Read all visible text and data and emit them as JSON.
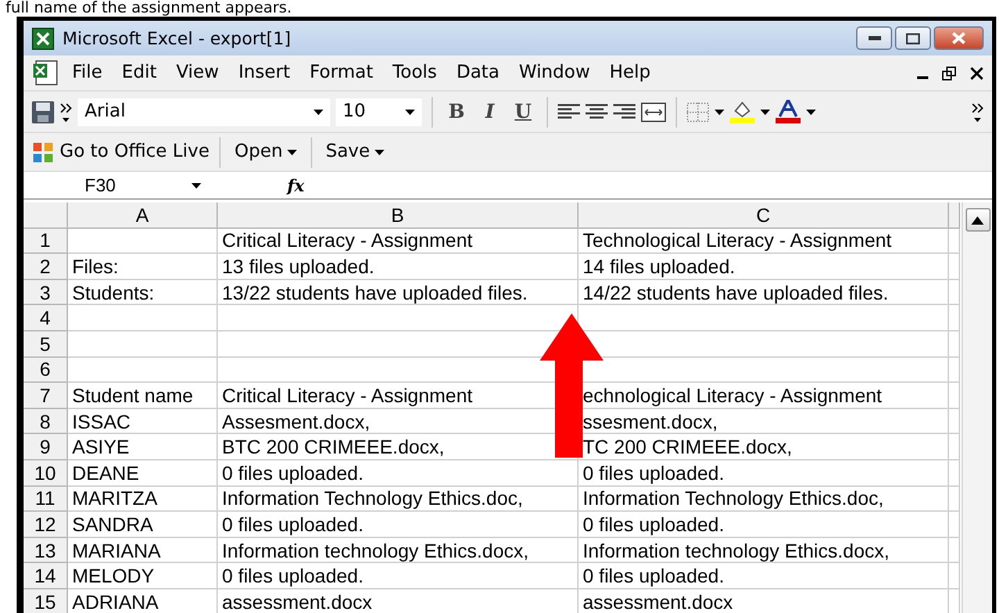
{
  "caption": "full name of the assignment appears.",
  "window": {
    "title": "Microsoft Excel - export[1]"
  },
  "menu": [
    "File",
    "Edit",
    "View",
    "Insert",
    "Format",
    "Tools",
    "Data",
    "Window",
    "Help"
  ],
  "toolbar": {
    "font": "Arial",
    "size": "10",
    "bold": "B",
    "italic": "I",
    "underline": "U"
  },
  "office_toolbar": {
    "live": "Go to Office Live",
    "open": "Open",
    "save": "Save"
  },
  "formula_bar": {
    "name_box": "F30",
    "fx": "fx"
  },
  "columns": [
    "A",
    "B",
    "C"
  ],
  "rows": [
    {
      "number": "1",
      "b": "Critical Literacy - Assignment",
      "c": "Technological Literacy - Assignment"
    },
    {
      "number": "2",
      "a": "Files:",
      "b": "13 files uploaded.",
      "c": "14 files uploaded."
    },
    {
      "number": "3",
      "a": "Students:",
      "b": "13/22 students have uploaded files.",
      "c": "14/22 students have uploaded files."
    },
    {
      "number": "4"
    },
    {
      "number": "5"
    },
    {
      "number": "6"
    },
    {
      "number": "7",
      "a": "Student name",
      "b": "Critical Literacy - Assignment",
      "c": "echnological Literacy - Assignment"
    },
    {
      "number": "8",
      "a": "ISSAC",
      "b": "Assesment.docx,",
      "c": "ssesment.docx,"
    },
    {
      "number": "9",
      "a": "ASIYE",
      "b": "BTC 200 CRIMEEE.docx,",
      "c": "TC 200 CRIMEEE.docx,"
    },
    {
      "number": "10",
      "a": "DEANE",
      "b": "0 files uploaded.",
      "c": "0 files uploaded."
    },
    {
      "number": "11",
      "a": "MARITZA",
      "b": "Information Technology Ethics.doc,",
      "c": "Information Technology Ethics.doc,"
    },
    {
      "number": "12",
      "a": "SANDRA",
      "b": "0 files uploaded.",
      "c": "0 files uploaded."
    },
    {
      "number": "13",
      "a": "MARIANA",
      "b": "Information technology Ethics.docx,",
      "c": "Information technology Ethics.docx,"
    },
    {
      "number": "14",
      "a": "MELODY",
      "b": "0 files uploaded.",
      "c": "0 files uploaded."
    },
    {
      "number": "15",
      "a": "ADRIANA",
      "b": "assessment.docx",
      "c": "assessment.docx"
    }
  ]
}
